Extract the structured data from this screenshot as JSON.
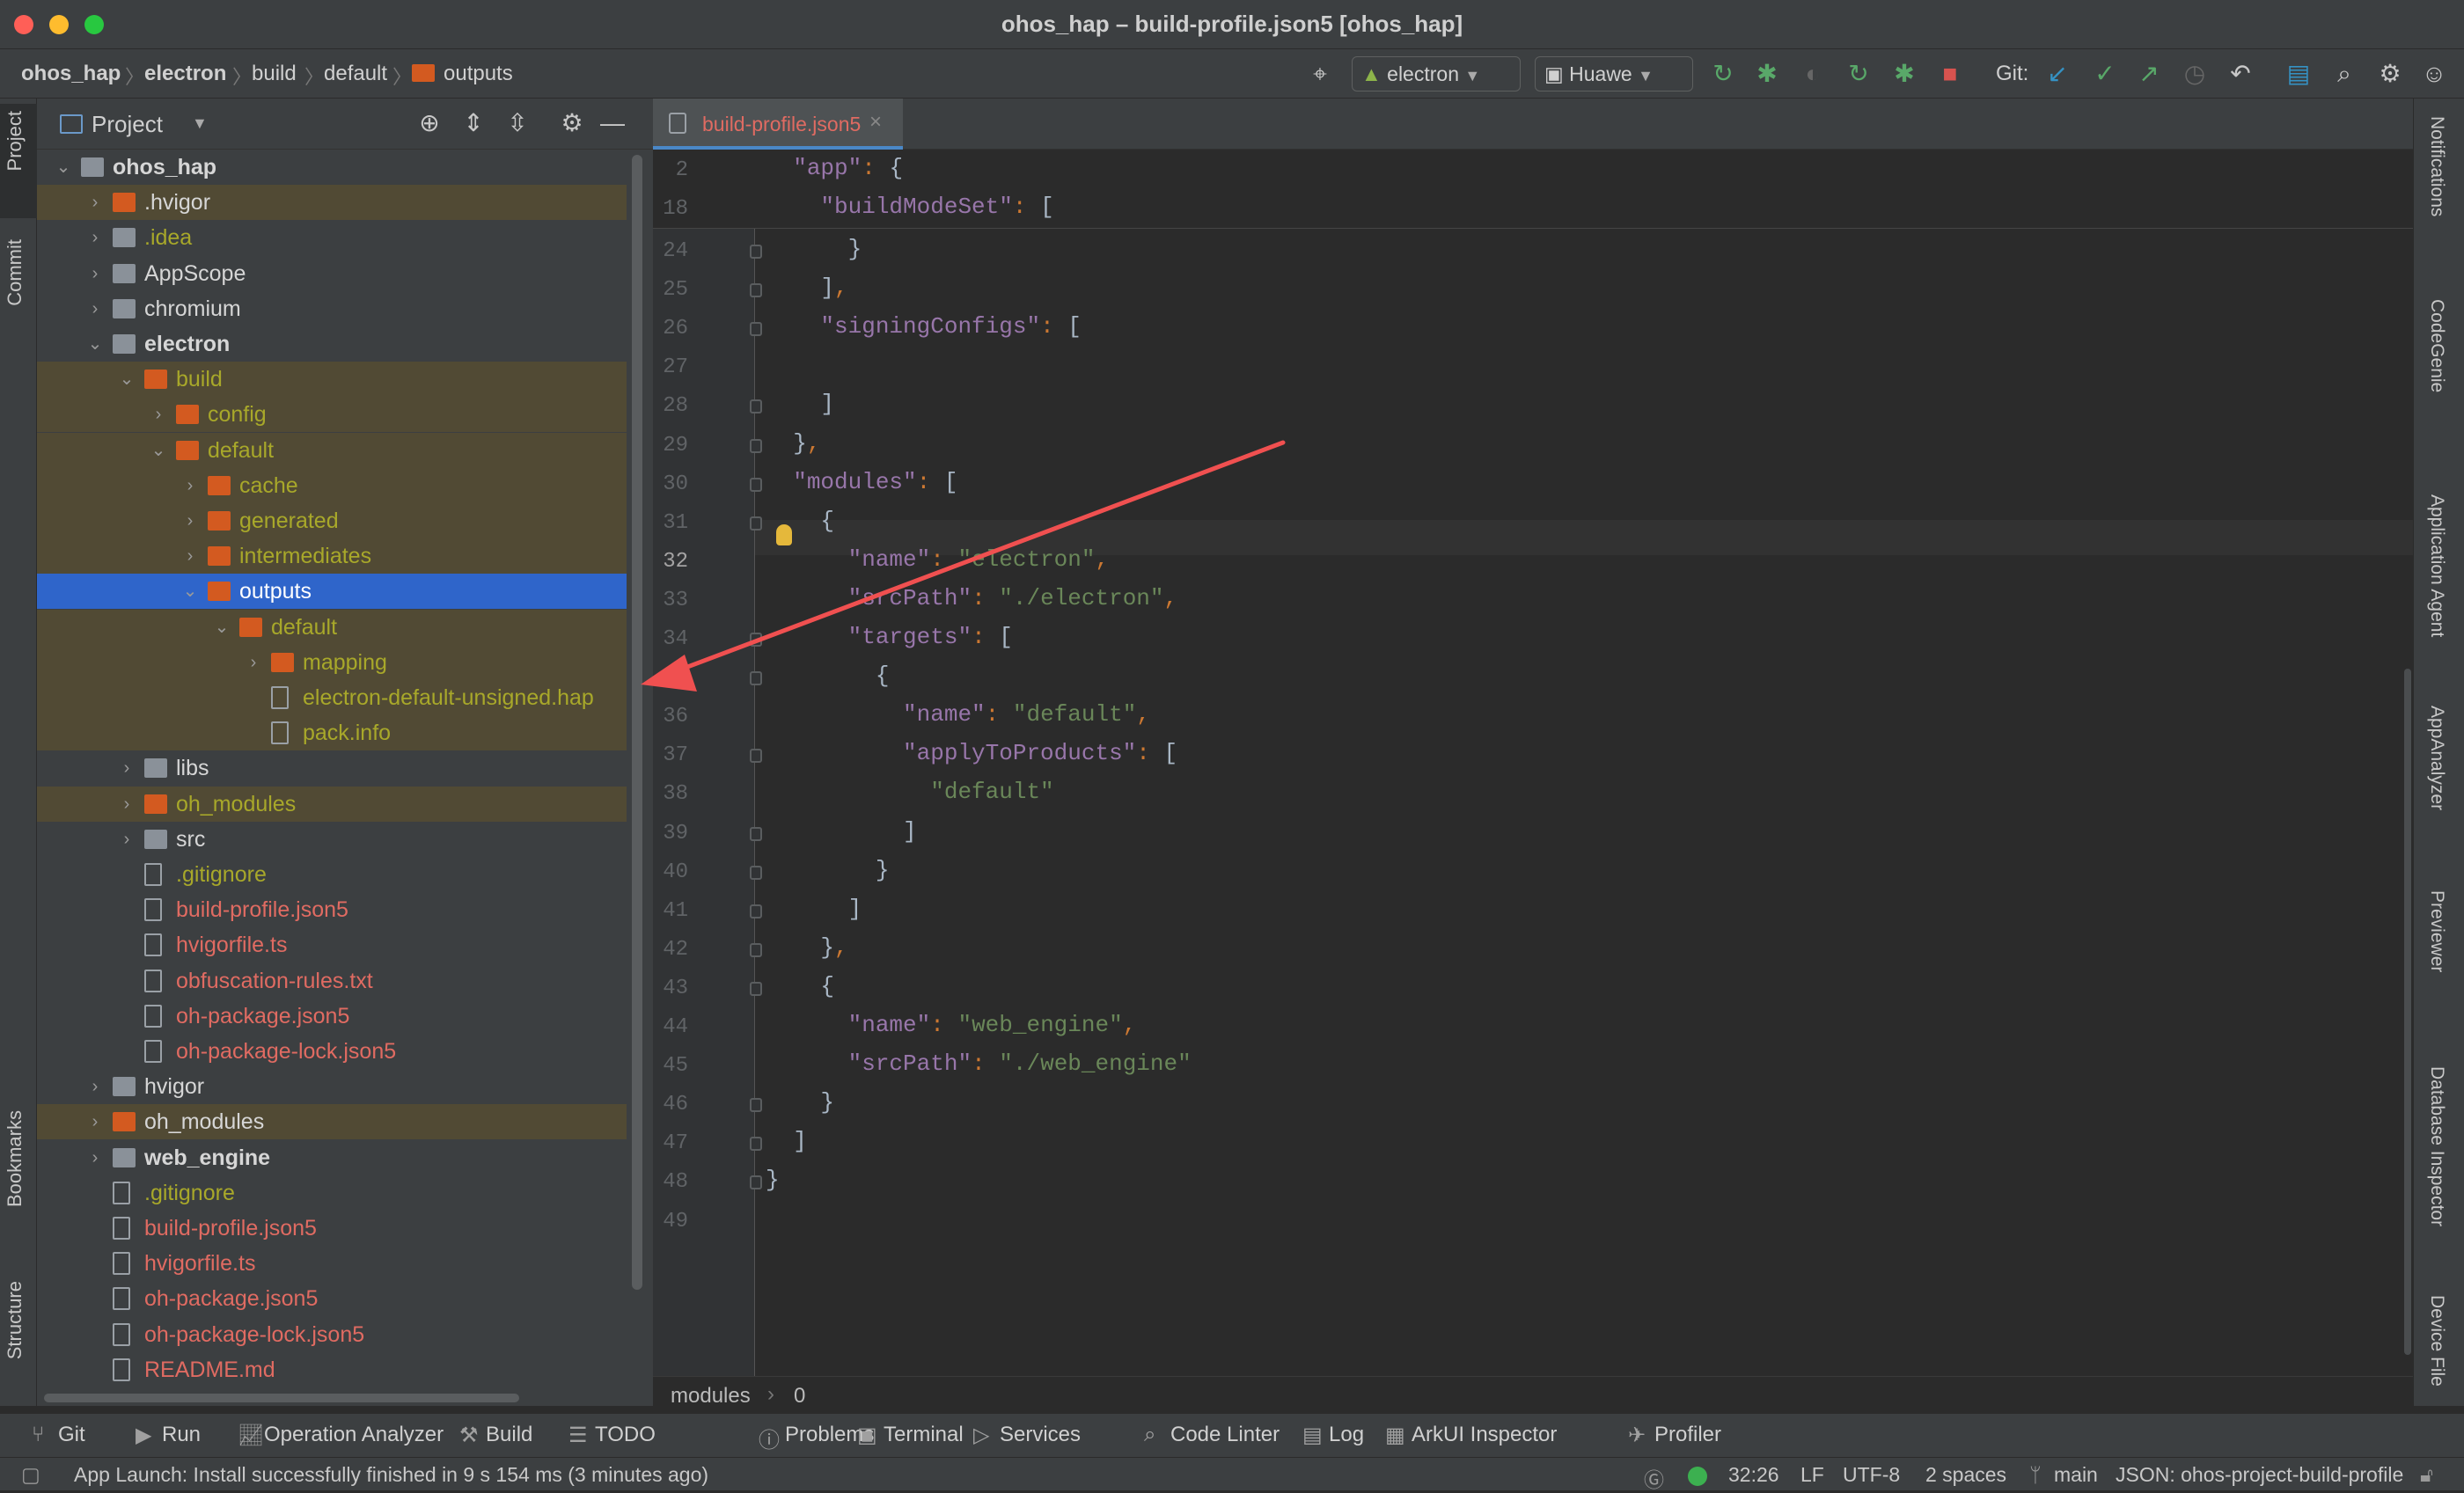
{
  "window": {
    "title": "ohos_hap – build-profile.json5 [ohos_hap]"
  },
  "breadcrumb": {
    "items": [
      "ohos_hap",
      "electron",
      "build",
      "default",
      "outputs"
    ]
  },
  "toolbar": {
    "run_config": "electron",
    "device": "Huawe",
    "git_label": "Git:"
  },
  "left_strip": {
    "project": "Project",
    "commit": "Commit",
    "bookmarks": "Bookmarks",
    "structure": "Structure"
  },
  "project_panel": {
    "title": "Project"
  },
  "tree": [
    {
      "label": "ohos_hap",
      "color": "c-white",
      "bold": true,
      "folder": "gr",
      "depth": 0,
      "open": true
    },
    {
      "label": ".hvigor",
      "color": "c-white",
      "folder": "or",
      "depth": 1,
      "open": false,
      "band": true
    },
    {
      "label": ".idea",
      "color": "c-ign",
      "folder": "gr",
      "depth": 1,
      "open": false
    },
    {
      "label": "AppScope",
      "color": "c-white",
      "folder": "gr",
      "depth": 1,
      "open": false
    },
    {
      "label": "chromium",
      "color": "c-white",
      "folder": "gr",
      "depth": 1,
      "open": false
    },
    {
      "label": "electron",
      "color": "c-white",
      "bold": true,
      "folder": "gr",
      "depth": 1,
      "open": true
    },
    {
      "label": "build",
      "color": "c-ign",
      "folder": "or",
      "depth": 2,
      "open": true,
      "band": true
    },
    {
      "label": "config",
      "color": "c-ign",
      "folder": "or",
      "depth": 3,
      "open": false,
      "band": true
    },
    {
      "label": "default",
      "color": "c-ign",
      "folder": "or",
      "depth": 3,
      "open": true,
      "band": true
    },
    {
      "label": "cache",
      "color": "c-ign",
      "folder": "or",
      "depth": 4,
      "open": false,
      "band": true
    },
    {
      "label": "generated",
      "color": "c-ign",
      "folder": "or",
      "depth": 4,
      "open": false,
      "band": true
    },
    {
      "label": "intermediates",
      "color": "c-ign",
      "folder": "or",
      "depth": 4,
      "open": false,
      "band": true
    },
    {
      "label": "outputs",
      "color": "c-sel",
      "folder": "or",
      "depth": 4,
      "open": true,
      "selected": true
    },
    {
      "label": "default",
      "color": "c-ign",
      "folder": "or",
      "depth": 5,
      "open": true,
      "band": true
    },
    {
      "label": "mapping",
      "color": "c-ign",
      "folder": "or",
      "depth": 6,
      "open": false,
      "band": true
    },
    {
      "label": "electron-default-unsigned.hap",
      "color": "c-ign",
      "file": true,
      "depth": 6,
      "band": true
    },
    {
      "label": "pack.info",
      "color": "c-ign",
      "file": true,
      "depth": 6,
      "band": true
    },
    {
      "label": "libs",
      "color": "c-white",
      "folder": "gr",
      "depth": 2,
      "open": false
    },
    {
      "label": "oh_modules",
      "color": "c-ign",
      "folder": "or",
      "depth": 2,
      "open": false,
      "band": true
    },
    {
      "label": "src",
      "color": "c-white",
      "folder": "gr",
      "depth": 2,
      "open": false
    },
    {
      "label": ".gitignore",
      "color": "c-ign",
      "file": true,
      "depth": 2
    },
    {
      "label": "build-profile.json5",
      "color": "c-red",
      "file": true,
      "depth": 2
    },
    {
      "label": "hvigorfile.ts",
      "color": "c-red",
      "file": true,
      "depth": 2
    },
    {
      "label": "obfuscation-rules.txt",
      "color": "c-red",
      "file": true,
      "depth": 2
    },
    {
      "label": "oh-package.json5",
      "color": "c-red",
      "file": true,
      "depth": 2
    },
    {
      "label": "oh-package-lock.json5",
      "color": "c-red",
      "file": true,
      "depth": 2
    },
    {
      "label": "hvigor",
      "color": "c-white",
      "folder": "gr",
      "depth": 1,
      "open": false
    },
    {
      "label": "oh_modules",
      "color": "c-white",
      "folder": "or",
      "depth": 1,
      "open": false,
      "band": true
    },
    {
      "label": "web_engine",
      "color": "c-white",
      "bold": true,
      "folder": "gr",
      "depth": 1,
      "open": false
    },
    {
      "label": ".gitignore",
      "color": "c-ign",
      "file": true,
      "depth": 1
    },
    {
      "label": "build-profile.json5",
      "color": "c-red",
      "file": true,
      "depth": 1
    },
    {
      "label": "hvigorfile.ts",
      "color": "c-red",
      "file": true,
      "depth": 1
    },
    {
      "label": "oh-package.json5",
      "color": "c-red",
      "file": true,
      "depth": 1
    },
    {
      "label": "oh-package-lock.json5",
      "color": "c-red",
      "file": true,
      "depth": 1
    },
    {
      "label": "README.md",
      "color": "c-red",
      "file": true,
      "depth": 1
    }
  ],
  "editor": {
    "tab_label": "build-profile.json5",
    "sticky": [
      {
        "num": "2",
        "html": "  <span class=\"key\">\"app\"</span><span class=\"pun\">:</span> {"
      },
      {
        "num": "18",
        "html": "    <span class=\"key\">\"buildModeSet\"</span><span class=\"pun\">:</span> ["
      }
    ],
    "lines": [
      {
        "num": "24",
        "html": "      }"
      },
      {
        "num": "25",
        "html": "    ]<span class=\"pun\">,</span>"
      },
      {
        "num": "26",
        "html": "    <span class=\"key\">\"signingConfigs\"</span><span class=\"pun\">:</span> ["
      },
      {
        "num": "27",
        "html": ""
      },
      {
        "num": "28",
        "html": "    ]"
      },
      {
        "num": "29",
        "html": "  }<span class=\"pun\">,</span>"
      },
      {
        "num": "30",
        "html": "  <span class=\"key\">\"modules\"</span><span class=\"pun\">:</span> ["
      },
      {
        "num": "31",
        "html": "    {"
      },
      {
        "num": "32",
        "html": "      <span class=\"key\">\"name\"</span><span class=\"pun\">:</span> <span class=\"str\">\"electron\"</span><span class=\"pun\">,</span>"
      },
      {
        "num": "33",
        "html": "      <span class=\"key\">\"srcPath\"</span><span class=\"pun\">:</span> <span class=\"str\">\"./electron\"</span><span class=\"pun\">,</span>"
      },
      {
        "num": "34",
        "html": "      <span class=\"key\">\"targets\"</span><span class=\"pun\">:</span> ["
      },
      {
        "num": "35",
        "html": "        {"
      },
      {
        "num": "36",
        "html": "          <span class=\"key\">\"name\"</span><span class=\"pun\">:</span> <span class=\"str\">\"default\"</span><span class=\"pun\">,</span>"
      },
      {
        "num": "37",
        "html": "          <span class=\"key\">\"applyToProducts\"</span><span class=\"pun\">:</span> ["
      },
      {
        "num": "38",
        "html": "            <span class=\"str\">\"default\"</span>"
      },
      {
        "num": "39",
        "html": "          ]"
      },
      {
        "num": "40",
        "html": "        }"
      },
      {
        "num": "41",
        "html": "      ]"
      },
      {
        "num": "42",
        "html": "    }<span class=\"pun\">,</span>"
      },
      {
        "num": "43",
        "html": "    {"
      },
      {
        "num": "44",
        "html": "      <span class=\"key\">\"name\"</span><span class=\"pun\">:</span> <span class=\"str\">\"web_engine\"</span><span class=\"pun\">,</span>"
      },
      {
        "num": "45",
        "html": "      <span class=\"key\">\"srcPath\"</span><span class=\"pun\">:</span> <span class=\"str\">\"./web_engine\"</span>"
      },
      {
        "num": "46",
        "html": "    }"
      },
      {
        "num": "47",
        "html": "  ]"
      },
      {
        "num": "48",
        "html": "}"
      },
      {
        "num": "49",
        "html": ""
      }
    ]
  },
  "code_breadcrumb": {
    "a": "modules",
    "b": "0"
  },
  "right_strip": [
    "Notifications",
    "CodeGenie",
    "Application Agent",
    "AppAnalyzer",
    "Previewer",
    "Database Inspector",
    "Device File"
  ],
  "tool_windows": [
    "Git",
    "Run",
    "Operation Analyzer",
    "Build",
    "TODO",
    "Problems",
    "Terminal",
    "Services",
    "Code Linter",
    "Log",
    "ArkUI Inspector",
    "Profiler"
  ],
  "status": {
    "message": "App Launch: Install successfully finished in 9 s 154 ms (3 minutes ago)",
    "position": "32:26",
    "line_sep": "LF",
    "encoding": "UTF-8",
    "indent": "2 spaces",
    "branch": "main",
    "schema": "JSON: ohos-project-build-profile"
  },
  "colors": {
    "selection": "#2f65ca",
    "ignored_band": "#514a34",
    "annotation_arrow": "#f05050"
  }
}
